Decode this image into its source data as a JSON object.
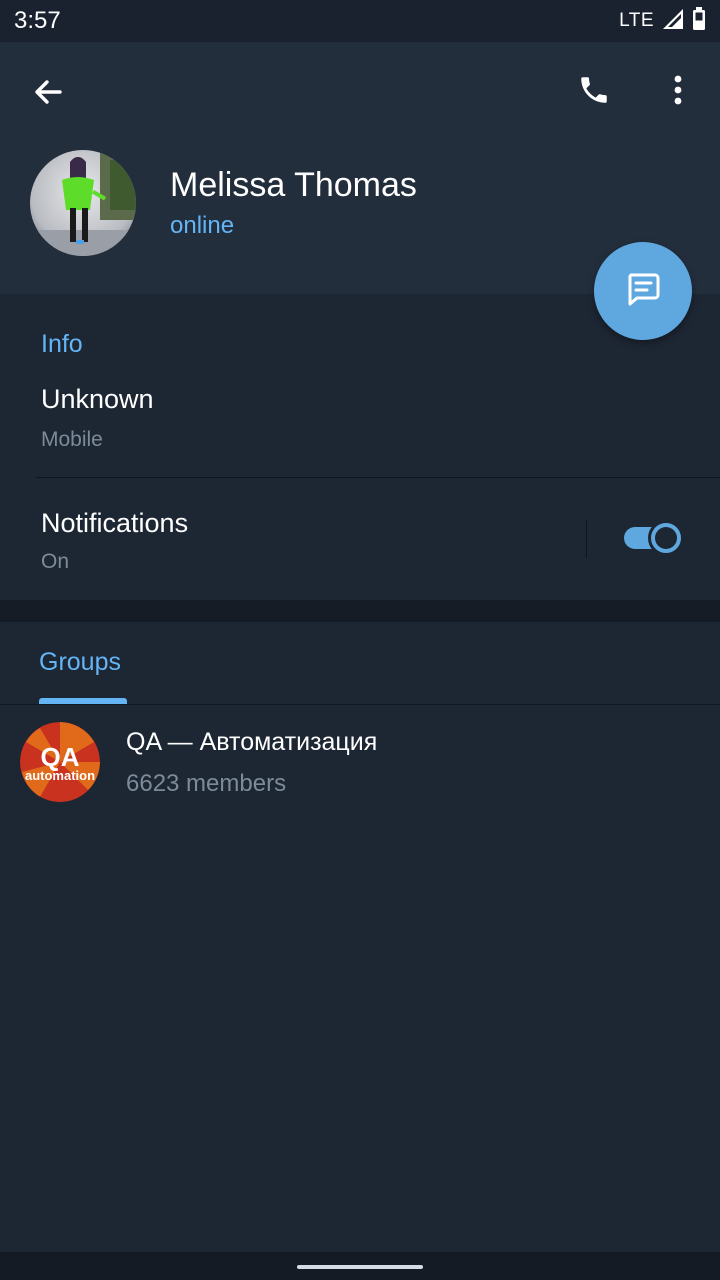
{
  "status_bar": {
    "time": "3:57",
    "network": "LTE",
    "signal_icon": "signal-icon",
    "battery_icon": "battery-icon"
  },
  "header": {
    "back_icon": "arrow-left-icon",
    "call_icon": "phone-icon",
    "more_icon": "more-vertical-icon"
  },
  "profile": {
    "name": "Melissa Thomas",
    "status": "online"
  },
  "fab": {
    "icon": "message-icon"
  },
  "info": {
    "section_title": "Info",
    "phone_value": "Unknown",
    "phone_label": "Mobile",
    "notifications_title": "Notifications",
    "notifications_value": "On",
    "notifications_enabled": true
  },
  "groups": {
    "tab_label": "Groups",
    "items": [
      {
        "name": "QA — Автоматизация",
        "members": "6623 members",
        "avatar_text_main": "QA",
        "avatar_text_sub": "automation"
      }
    ]
  },
  "colors": {
    "accent": "#64b5f6",
    "fab": "#5fa8df",
    "header_bg": "#232e3d",
    "body_bg": "#1d2633",
    "secondary_text": "#7d8b99"
  }
}
